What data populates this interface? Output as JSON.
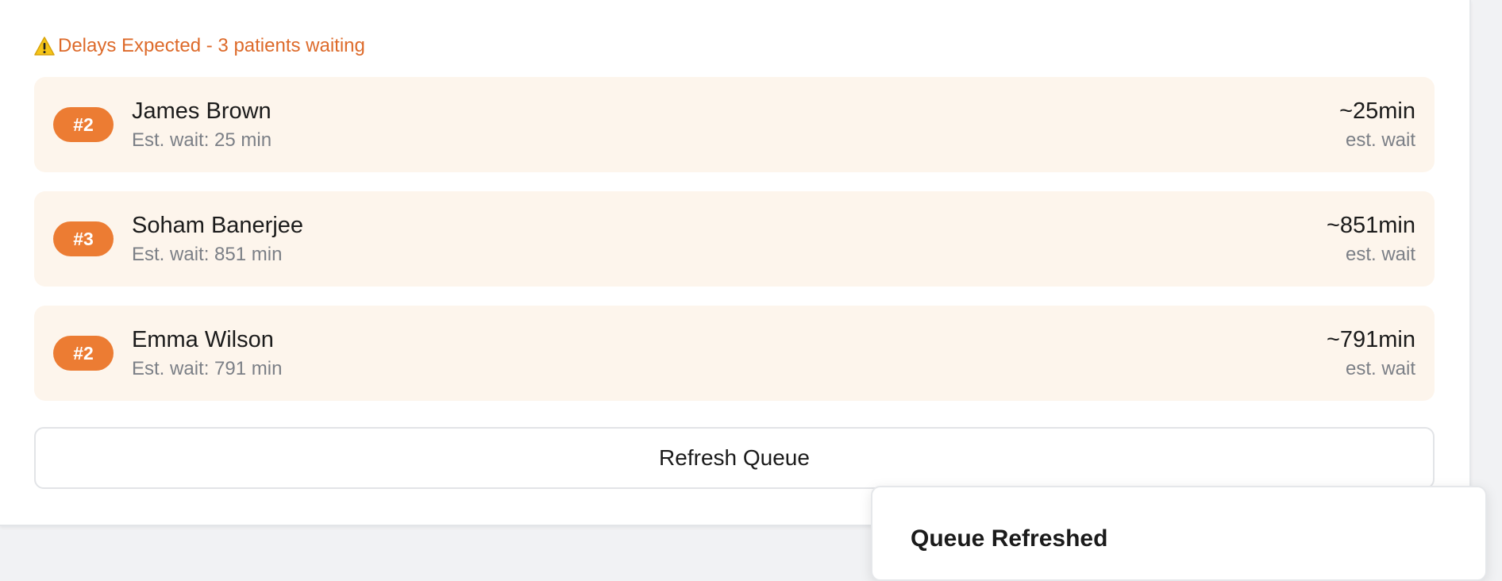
{
  "alert": {
    "icon": "warning-icon",
    "text": "Delays Expected - 3 patients waiting",
    "color": "#dd6a2a"
  },
  "queue": [
    {
      "position": "#2",
      "name": "James Brown",
      "subtitle": "Est. wait: 25 min",
      "wait": "~25min",
      "wait_label": "est. wait"
    },
    {
      "position": "#3",
      "name": "Soham Banerjee",
      "subtitle": "Est. wait: 851 min",
      "wait": "~851min",
      "wait_label": "est. wait"
    },
    {
      "position": "#2",
      "name": "Emma Wilson",
      "subtitle": "Est. wait: 791 min",
      "wait": "~791min",
      "wait_label": "est. wait"
    }
  ],
  "refresh_button": {
    "label": "Refresh Queue"
  },
  "toast": {
    "title": "Queue Refreshed"
  },
  "colors": {
    "accent": "#ec7c33",
    "item_background": "#fdf5ec",
    "muted_text": "#7b7f86"
  }
}
